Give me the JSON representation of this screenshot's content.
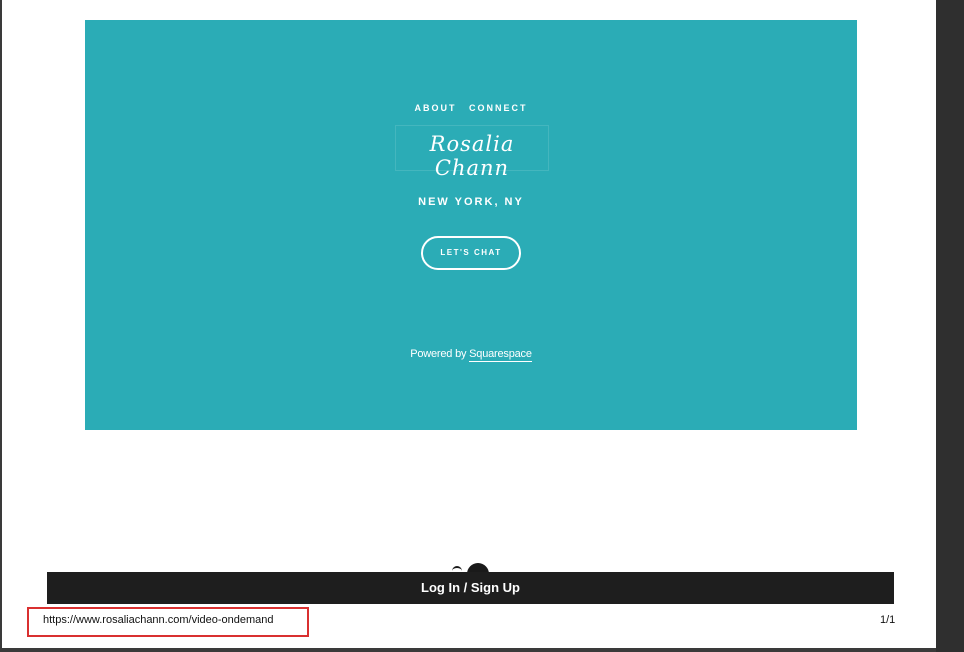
{
  "nav": {
    "items": [
      {
        "label": "ABOUT"
      },
      {
        "label": "CONNECT"
      }
    ]
  },
  "site": {
    "logo_text": "Rosalia Chann",
    "location": "NEW YORK, NY",
    "cta_label": "LET'S CHAT"
  },
  "footer": {
    "powered_prefix": "Powered by",
    "powered_link": "Squarespace"
  },
  "login_bar": {
    "label": "Log In / Sign Up"
  },
  "print_footer": {
    "url": "https://www.rosaliachann.com/video-ondemand",
    "page_count": "1/1"
  },
  "colors": {
    "panel": "#2bacb6",
    "login_bar": "#1e1e1e",
    "highlight_border": "#d93030"
  }
}
